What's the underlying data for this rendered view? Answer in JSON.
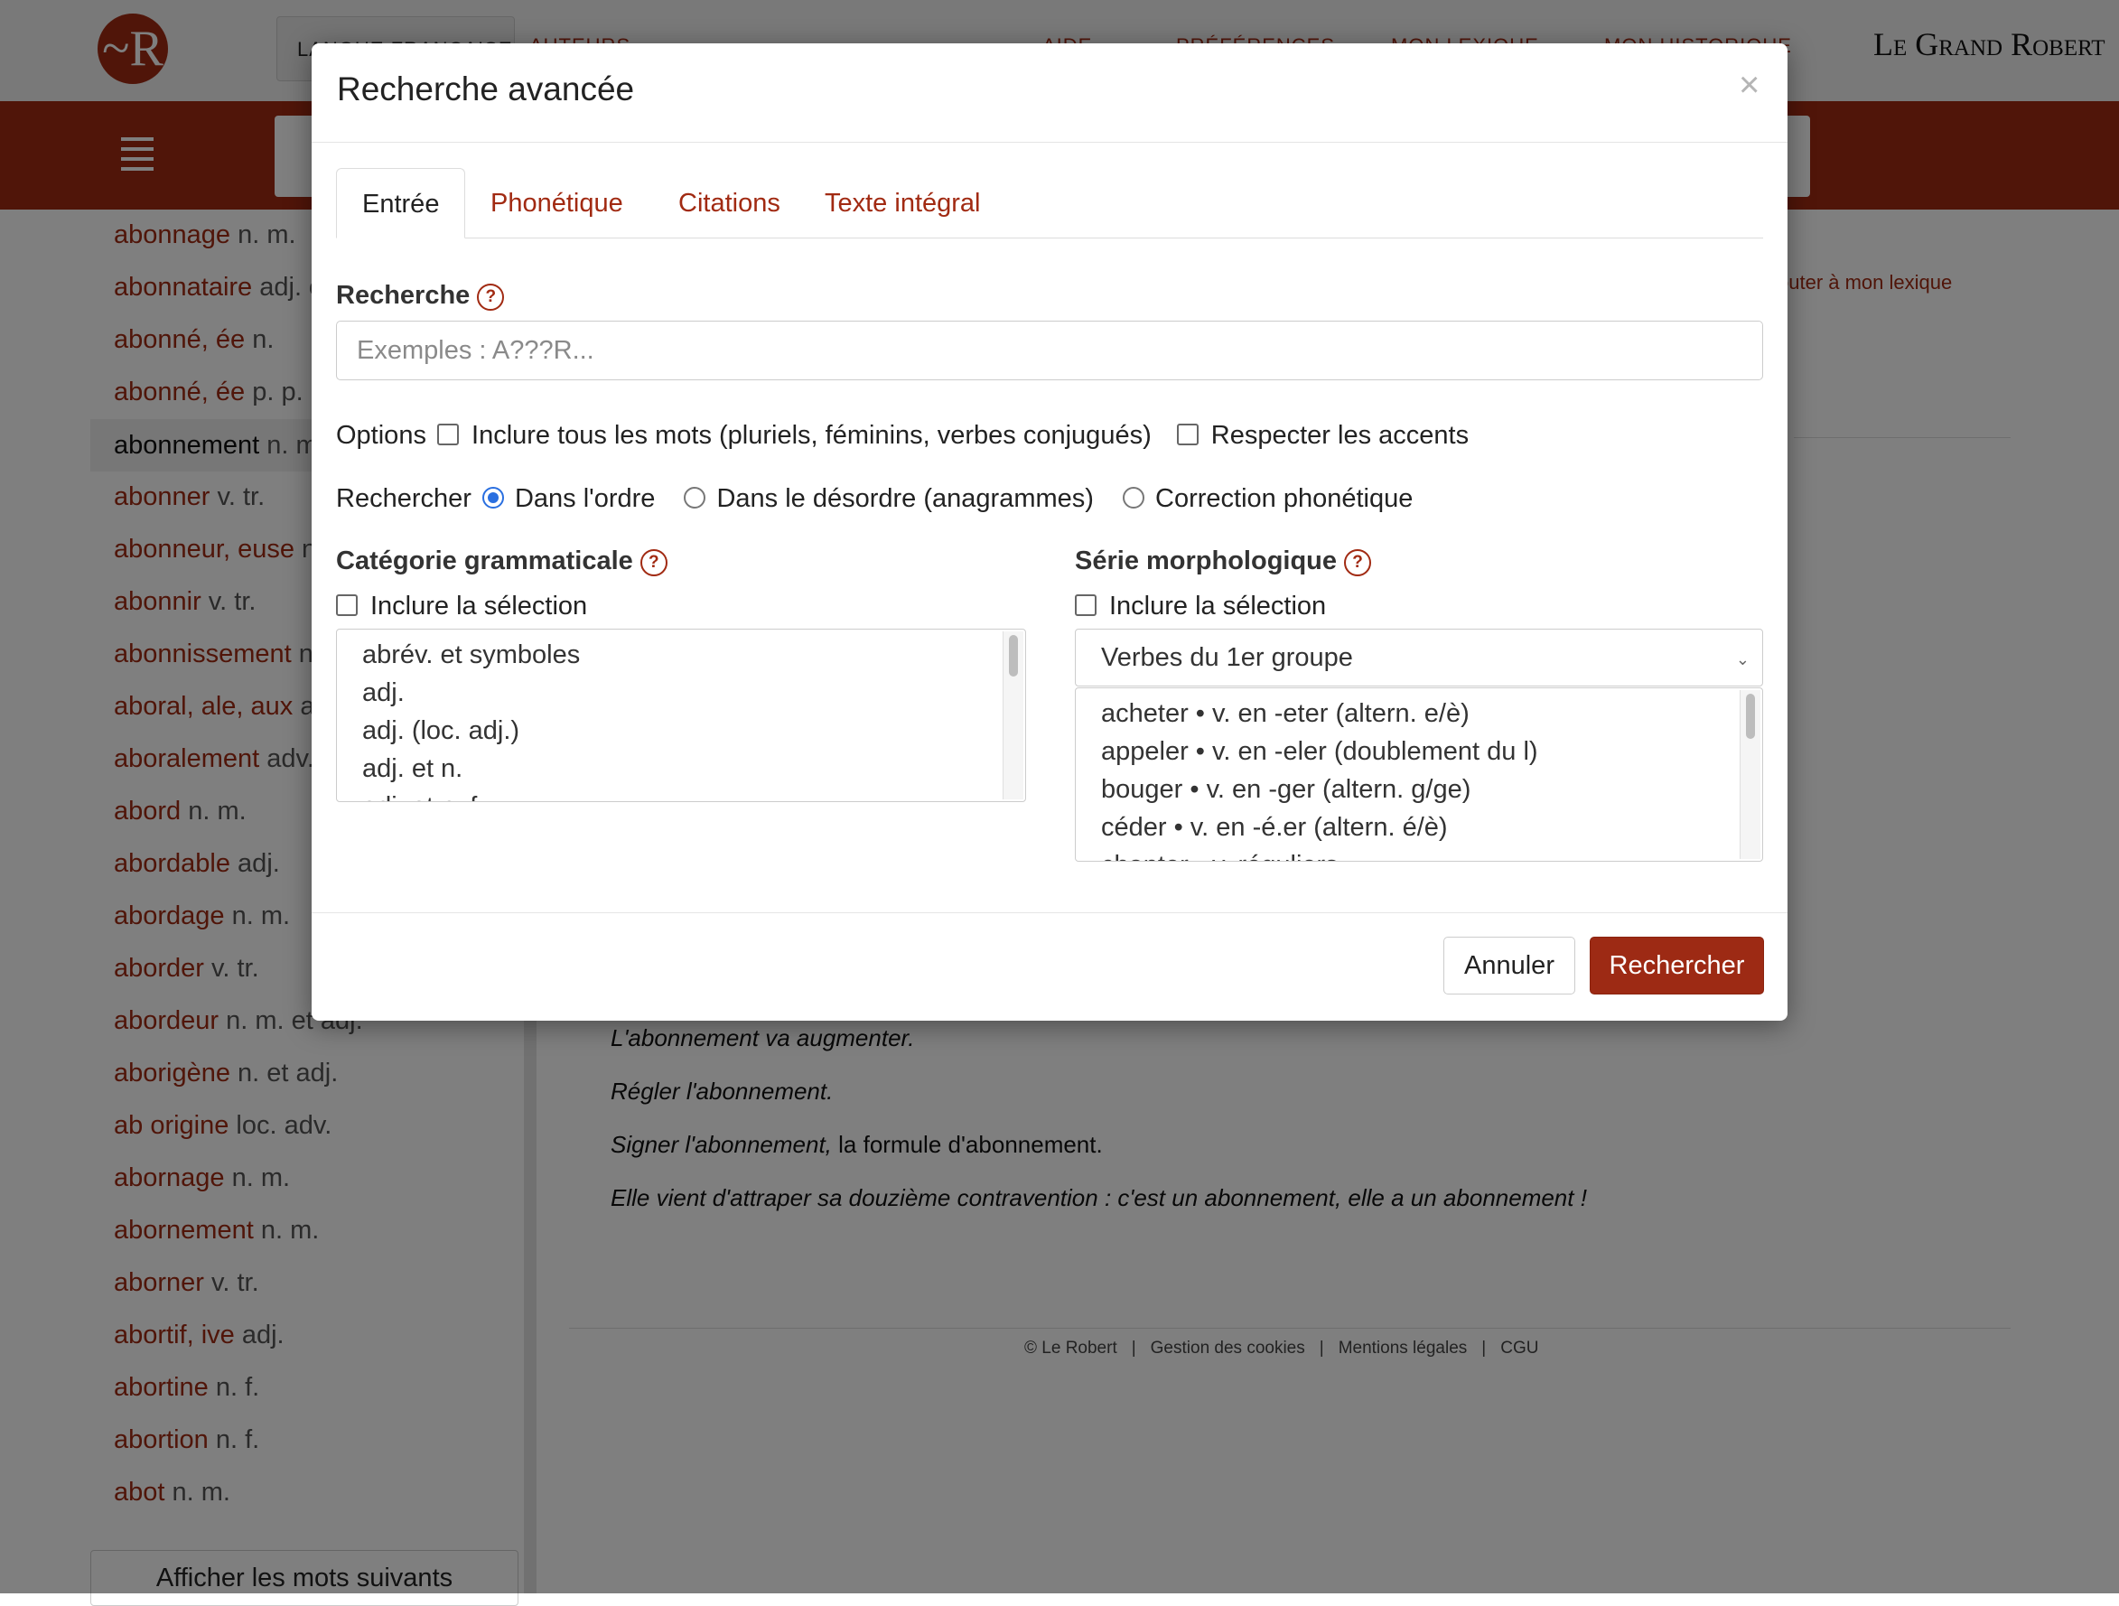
{
  "header": {
    "logo_letter": "~R",
    "lang_button": "LANGUE FRANÇAISE",
    "nav": [
      "AUTEURS",
      "AIDE",
      "PRÉFÉRENCES",
      "MON LEXIQUE",
      "MON HISTORIQUE"
    ],
    "brand": "Le Grand Robert"
  },
  "sidebar": {
    "items": [
      {
        "word": "abonnage",
        "gram": " n. m."
      },
      {
        "word": "abonnataire",
        "gram": " adj. ou n."
      },
      {
        "word": "abonné, ée",
        "gram": " n."
      },
      {
        "word": "abonné, ée",
        "gram": " p. p. adj."
      },
      {
        "word": "abonnement",
        "gram": " n. m."
      },
      {
        "word": "abonner",
        "gram": " v. tr."
      },
      {
        "word": "abonneur, euse",
        "gram": " n."
      },
      {
        "word": "abonnir",
        "gram": " v. tr."
      },
      {
        "word": "abonnissement",
        "gram": " n. m."
      },
      {
        "word": "aboral, ale, aux",
        "gram": " adj."
      },
      {
        "word": "aboralement",
        "gram": " adv."
      },
      {
        "word": "abord",
        "gram": " n. m."
      },
      {
        "word": "abordable",
        "gram": " adj."
      },
      {
        "word": "abordage",
        "gram": " n. m."
      },
      {
        "word": "aborder",
        "gram": " v. tr."
      },
      {
        "word": "abordeur",
        "gram": " n. m. et adj."
      },
      {
        "word": "aborigène",
        "gram": " n. et adj."
      },
      {
        "word": "ab origine",
        "gram": " loc. adv."
      },
      {
        "word": "abornage",
        "gram": " n. m."
      },
      {
        "word": "abornement",
        "gram": " n. m."
      },
      {
        "word": "aborner",
        "gram": " v. tr."
      },
      {
        "word": "abortif, ive",
        "gram": " adj."
      },
      {
        "word": "abortine",
        "gram": " n. f."
      },
      {
        "word": "abortion",
        "gram": " n. f."
      },
      {
        "word": "abot",
        "gram": " n. m."
      }
    ],
    "more_button": "Afficher les mots suivants"
  },
  "content": {
    "add_lexique": "outer à mon lexique",
    "examples": [
      {
        "italic": "L'abonnement va augmenter.",
        "normal": ""
      },
      {
        "italic": "Régler l'abonnement.",
        "normal": ""
      },
      {
        "italic": "Signer l'abonnement,",
        "normal": " la formule d'abonnement."
      },
      {
        "italic": "Elle vient d'attraper sa douzième contravention : c'est un abonnement, elle a un abonnement !",
        "normal": ""
      }
    ],
    "footer": [
      "© Le Robert",
      "Gestion des cookies",
      "Mentions légales",
      "CGU"
    ]
  },
  "modal": {
    "title": "Recherche avancée",
    "close": "×",
    "tabs": [
      "Entrée",
      "Phonétique",
      "Citations",
      "Texte intégral"
    ],
    "search_label": "Recherche",
    "help_glyph": "?",
    "search_placeholder": "Exemples : A???R...",
    "search_value": "",
    "options_label": "Options",
    "option1": "Inclure tous les mots (pluriels, féminins, verbes conjugués)",
    "option2": "Respecter les accents",
    "rechercher_label": "Rechercher",
    "radio1": "Dans l'ordre",
    "radio2": "Dans le désordre (anagrammes)",
    "radio3": "Correction phonétique",
    "cat_label": "Catégorie grammaticale",
    "cat_include": "Inclure la sélection",
    "cat_options": [
      "abrév. et symboles",
      "adj.",
      "adj. (loc. adj.)",
      "adj. et n.",
      "adj. et n. f."
    ],
    "morph_label": "Série morphologique",
    "morph_include": "Inclure la sélection",
    "morph_select": "Verbes du 1er groupe",
    "morph_options": [
      "acheter • v. en -eter (altern. e/è)",
      "appeler • v. en -eler (doublement du l)",
      "bouger • v. en -ger (altern. g/ge)",
      "céder • v. en -é.er (altern. é/è)",
      "chanter • v. réguliers"
    ],
    "cancel": "Annuler",
    "submit": "Rechercher"
  },
  "colors": {
    "brand_red": "#a12a12",
    "radio_blue": "#2a6fe0"
  }
}
